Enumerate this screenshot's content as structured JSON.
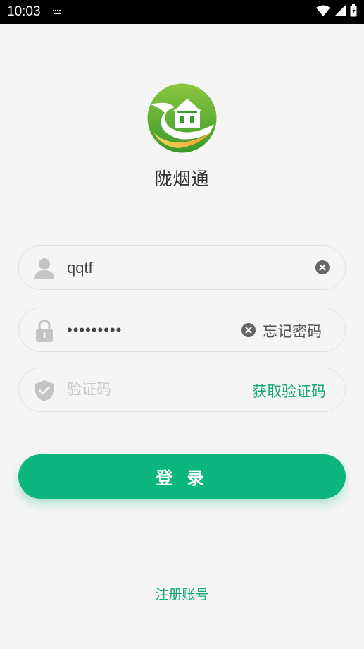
{
  "status_bar": {
    "time": "10:03",
    "icons": [
      "keyboard-icon",
      "wifi-icon",
      "signal-icon",
      "battery-icon"
    ]
  },
  "app": {
    "name": "陇烟通",
    "logo": "logo-icon"
  },
  "login_form": {
    "username": {
      "value": "qqtf",
      "icon": "user-icon"
    },
    "password": {
      "value": "•••••••••",
      "icon": "lock-icon",
      "forgot_label": "忘记密码"
    },
    "verification": {
      "placeholder": "验证码",
      "icon": "shield-icon",
      "get_code_label": "获取验证码"
    },
    "login_label": "登 录",
    "register_label": "注册账号"
  },
  "colors": {
    "accent": "#0db57f",
    "link": "#12a874",
    "background": "#f5f5f5"
  }
}
